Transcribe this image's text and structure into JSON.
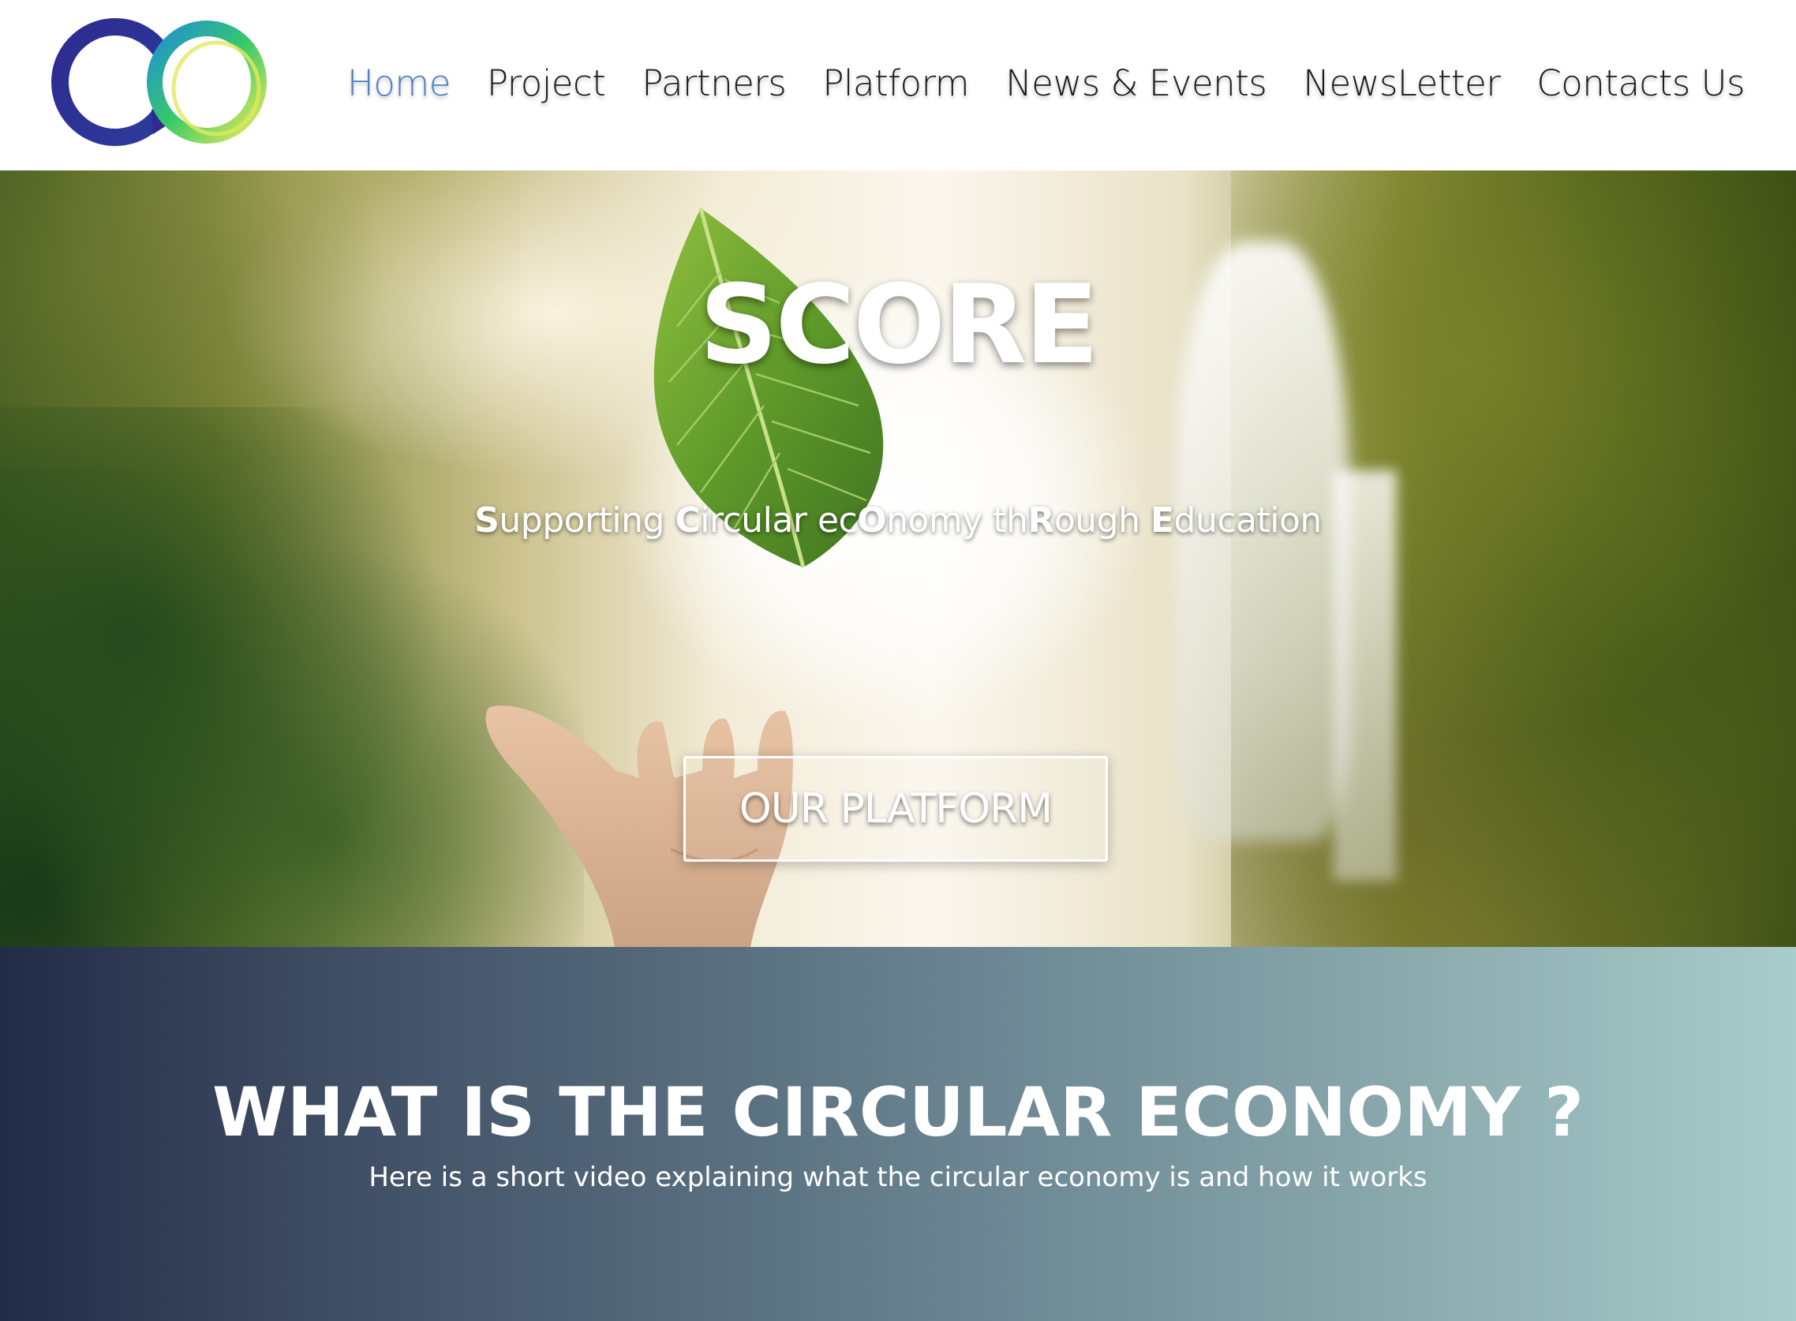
{
  "brand": {
    "logo_name": "score-circular-logo",
    "colors": {
      "logo_navy": "#2b2a8a",
      "logo_blue": "#2a7fd4",
      "logo_green": "#3ccf5a",
      "logo_yellow": "#e2e85c"
    }
  },
  "nav": {
    "active_color": "#4d7fc3",
    "items": [
      {
        "label": "Home",
        "active": true
      },
      {
        "label": "Project",
        "active": false
      },
      {
        "label": "Partners",
        "active": false
      },
      {
        "label": "Platform",
        "active": false
      },
      {
        "label": "News & Events",
        "active": false
      },
      {
        "label": "NewsLetter",
        "active": false
      },
      {
        "label": "Contacts Us",
        "active": false
      }
    ]
  },
  "hero": {
    "title": "SCORE",
    "subtitle_parts": [
      {
        "bold": "S",
        "rest": "upporting "
      },
      {
        "bold": "C",
        "rest": "ircular ec"
      },
      {
        "bold": "O",
        "rest": "nomy th"
      },
      {
        "bold": "R",
        "rest": "ough "
      },
      {
        "bold": "E",
        "rest": "ducation"
      }
    ],
    "cta_label": "OUR PLATFORM",
    "background": "leaf-floating-above-hand-waterfall-photo"
  },
  "circular_economy": {
    "title": "WHAT IS THE CIRCULAR ECONOMY ?",
    "subtitle": "Here is a short video explaining what the circular economy is and how it works",
    "gradient": [
      "#232c47",
      "#a8cccb"
    ]
  }
}
